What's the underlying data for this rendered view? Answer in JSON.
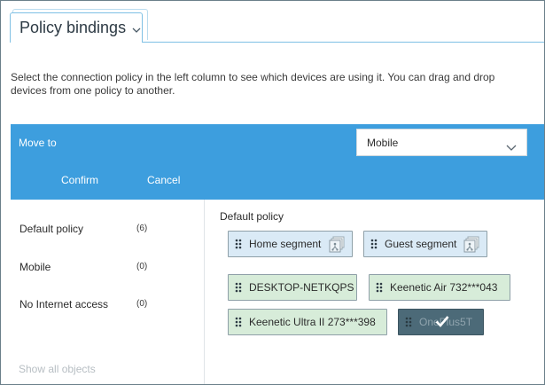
{
  "tab": {
    "title": "Policy bindings",
    "chevron_icon": "chevron-down-icon"
  },
  "description": "Select the connection policy in the left column to see which devices are using it. You can drag and drop devices from one policy to another.",
  "move_bar": {
    "label": "Move to",
    "selected_policy": "Mobile",
    "confirm_label": "Confirm",
    "cancel_label": "Cancel",
    "bar_color": "#3d9ede"
  },
  "policies": [
    {
      "label": "Default policy",
      "count": "(6)"
    },
    {
      "label": "Mobile",
      "count": "(0)"
    },
    {
      "label": "No Internet access",
      "count": "(0)"
    }
  ],
  "show_all_label": "Show all objects",
  "right_panel": {
    "title": "Default policy",
    "segments": [
      {
        "label": "Home segment",
        "icon": "segment-stack-icon"
      },
      {
        "label": "Guest segment",
        "icon": "segment-stack-icon"
      }
    ],
    "devices": [
      {
        "label": "DESKTOP-NETKQPS"
      },
      {
        "label": "Keenetic Air 732***043"
      },
      {
        "label": "Keenetic Ultra II 273***398"
      },
      {
        "label": "OnePlus5T",
        "selected": true,
        "icon": "checkmark-icon"
      }
    ]
  }
}
